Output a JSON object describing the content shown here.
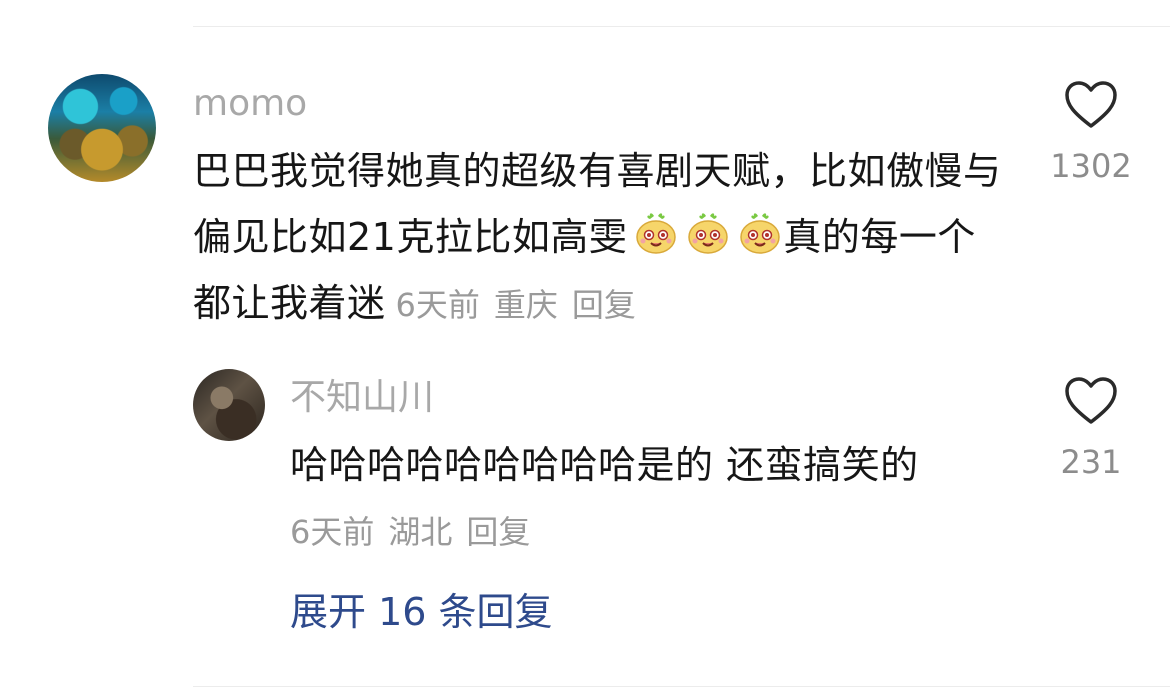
{
  "comment": {
    "username": "momo",
    "text_parts": [
      "巴巴我觉得她真的超级有喜剧天赋，比如傲慢与偏见比如21克拉比如高雯",
      "真的每一个都让我着迷"
    ],
    "emoji": "face-emoji",
    "time": "6天前",
    "location": "重庆",
    "reply_label": "回复",
    "like_count": "1302"
  },
  "reply": {
    "username": "不知山川",
    "text": "哈哈哈哈哈哈哈哈哈是的 还蛮搞笑的",
    "time": "6天前",
    "location": "湖北",
    "reply_label": "回复",
    "like_count": "231"
  },
  "expand_label": "展开 16 条回复",
  "colors": {
    "link": "#2e4a8c",
    "meta": "#9a9a9a",
    "username": "#a8a8a8"
  }
}
